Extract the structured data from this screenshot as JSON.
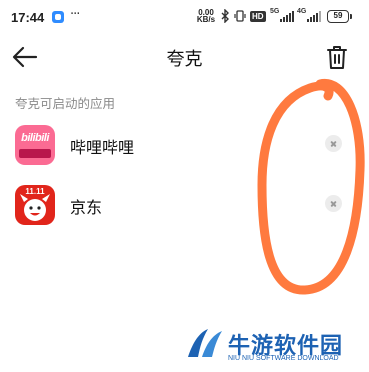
{
  "status_bar": {
    "time": "17:44",
    "dots": "···",
    "speed_value": "0.00",
    "speed_unit": "KB/s",
    "hd_badge": "HD",
    "net1": "5G",
    "net2": "4G",
    "battery": "59",
    "icons": [
      "app-notification-icon",
      "bluetooth-icon",
      "vibrate-icon",
      "signal-icon",
      "signal-icon"
    ]
  },
  "header": {
    "title": "夸克",
    "back_icon": "arrow-left-icon",
    "trash_icon": "trash-icon"
  },
  "section_label": "夸克可启动的应用",
  "apps": [
    {
      "name": "哔哩哔哩",
      "icon": "bilibili-app-icon",
      "icon_text": "bilibili"
    },
    {
      "name": "京东",
      "icon": "jd-app-icon",
      "icon_text": "11.11"
    }
  ],
  "watermark": {
    "name": "牛游软件园",
    "subtitle": "NIU NIU SOFTWARE DOWNLOAD"
  },
  "colors": {
    "annotation": "#ff7a3f",
    "bilibili": "#fb6b93",
    "jd": "#e1251b",
    "watermark": "#1d62b3"
  }
}
